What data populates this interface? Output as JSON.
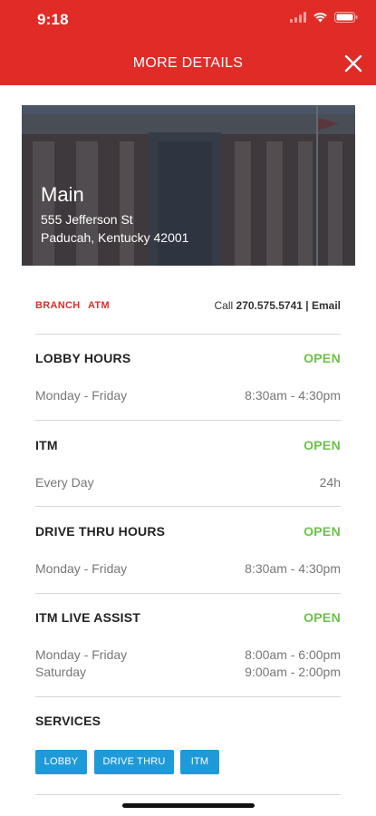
{
  "status": {
    "time": "9:18"
  },
  "header": {
    "title": "MORE DETAILS"
  },
  "branch": {
    "name": "Main",
    "address_line1": "555 Jefferson St",
    "address_line2": "Paducah, Kentucky 42001"
  },
  "tags": [
    "BRANCH",
    "ATM"
  ],
  "contact": {
    "call_label": "Call",
    "phone": "270.575.5741",
    "separator": "|",
    "email_label": "Email"
  },
  "sections": [
    {
      "title": "LOBBY HOURS",
      "status": "OPEN",
      "rows": [
        {
          "days": "Monday - Friday",
          "hours": "8:30am - 4:30pm"
        }
      ]
    },
    {
      "title": "ITM",
      "status": "OPEN",
      "rows": [
        {
          "days": "Every Day",
          "hours": "24h"
        }
      ]
    },
    {
      "title": "DRIVE THRU HOURS",
      "status": "OPEN",
      "rows": [
        {
          "days": "Monday - Friday",
          "hours": "8:30am - 4:30pm"
        }
      ]
    },
    {
      "title": "ITM LIVE ASSIST",
      "status": "OPEN",
      "rows": [
        {
          "days": "Monday - Friday",
          "hours": "8:00am - 6:00pm"
        },
        {
          "days": "Saturday",
          "hours": "9:00am - 2:00pm"
        }
      ]
    }
  ],
  "services": {
    "title": "SERVICES",
    "items": [
      "LOBBY",
      "DRIVE THRU",
      "ITM"
    ]
  },
  "colors": {
    "header_red": "#e12b27",
    "open_green": "#6cc24a",
    "chip_blue": "#1f9ad9",
    "tag_red": "#d9302a"
  }
}
